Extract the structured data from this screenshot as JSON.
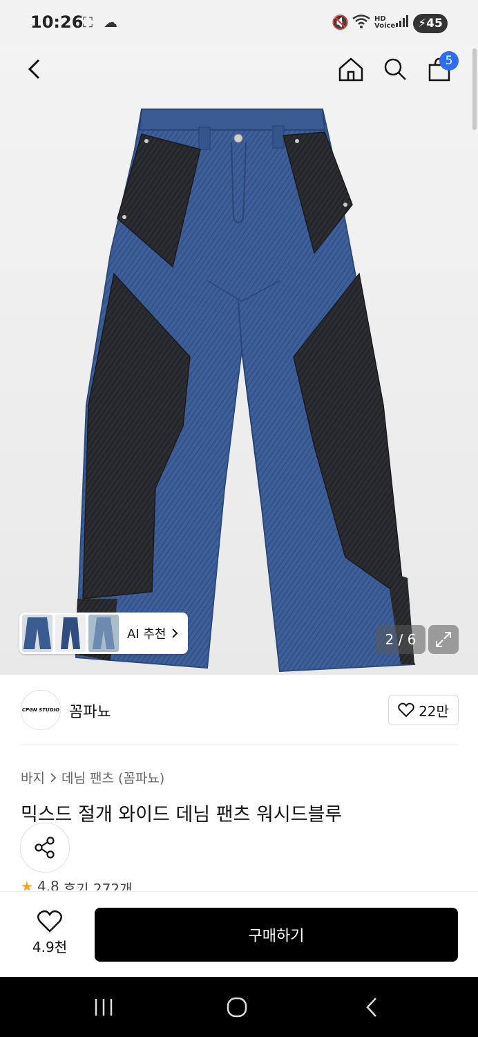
{
  "status_bar": {
    "time": "10:26",
    "battery": "45"
  },
  "header": {
    "cart_count": "5"
  },
  "gallery": {
    "page_indicator": "2 / 6",
    "ai_label": "AI 추천"
  },
  "brand": {
    "logo_text": "CPGN STUDIO",
    "name": "꼼파뇨",
    "likes": "22만"
  },
  "breadcrumb": {
    "category": "바지",
    "subcategory": "데님 팬츠 (꼼파뇨)"
  },
  "product": {
    "title": "믹스드 절개 와이드 데님 팬츠 워시드블루",
    "rating": "4.8",
    "reviews": "후기 272개"
  },
  "bottom_bar": {
    "wish_count": "4.9천",
    "buy_label": "구매하기"
  },
  "colors": {
    "accent": "#2d6cf5",
    "denim": "#3d5f9a",
    "black_denim": "#2a2c30",
    "star": "#f6a623"
  }
}
